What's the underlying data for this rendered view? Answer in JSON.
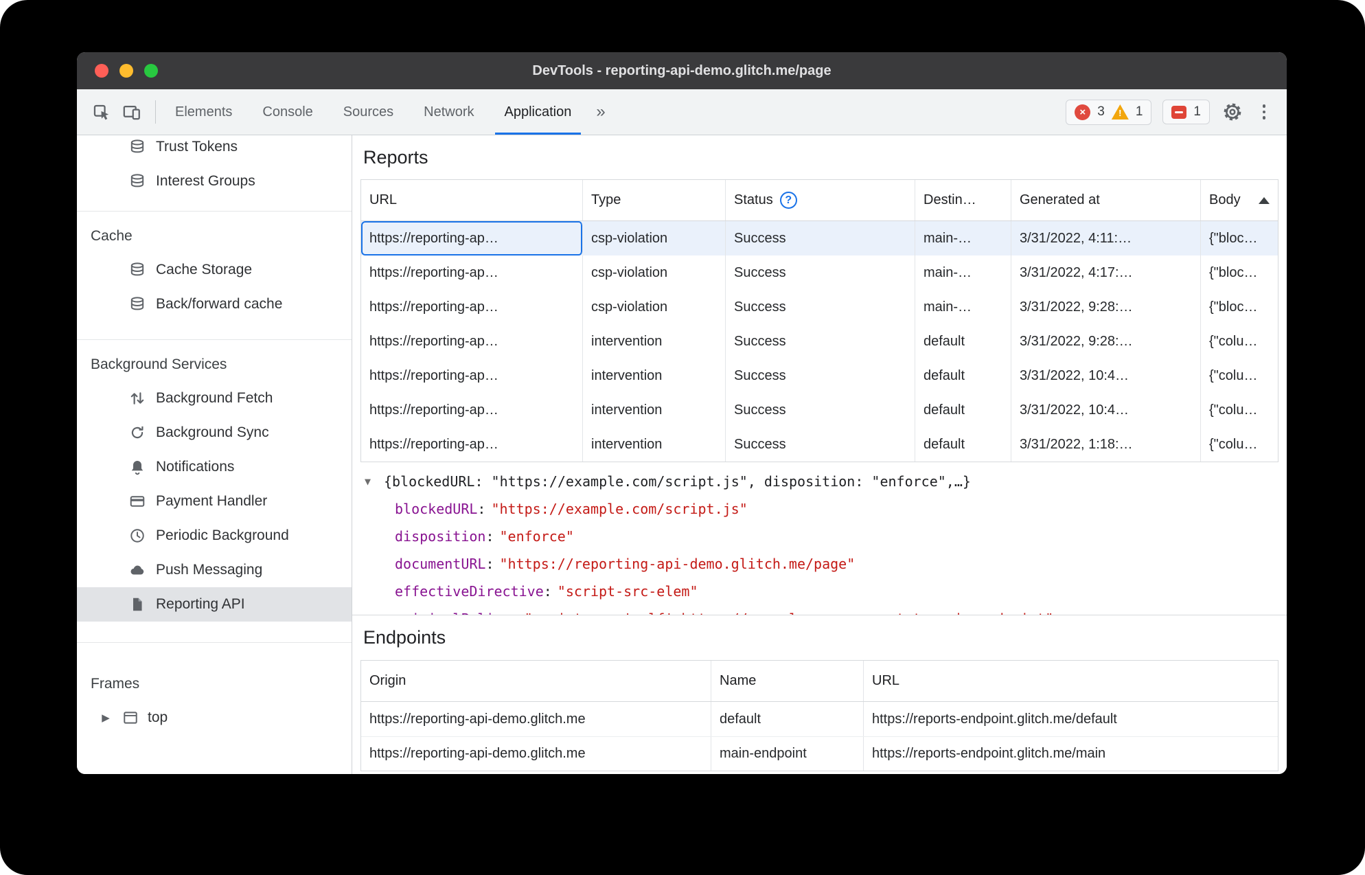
{
  "colors": {
    "accent": "#1a73e8",
    "error": "#e04a3f",
    "warning": "#f2a60d",
    "json_key": "#881391",
    "json_string": "#c41a16",
    "selected_row_bg": "#eaf1fb",
    "selected_sidebar_bg": "#e1e3e6"
  },
  "titlebar": {
    "title": "DevTools - reporting-api-demo.glitch.me/page"
  },
  "toolbar": {
    "tabs": [
      {
        "label": "Elements"
      },
      {
        "label": "Console"
      },
      {
        "label": "Sources"
      },
      {
        "label": "Network"
      },
      {
        "label": "Application"
      }
    ],
    "more_tabs_glyph": "»",
    "error_count": "3",
    "warning_count": "1",
    "issues_count": "1"
  },
  "sidebar": {
    "top_items": {
      "trust_tokens": "Trust Tokens",
      "interest_groups": "Interest Groups"
    },
    "cache": {
      "header": "Cache",
      "cache_storage": "Cache Storage",
      "back_forward_cache": "Back/forward cache"
    },
    "background_services": {
      "header": "Background Services",
      "background_fetch": "Background Fetch",
      "background_sync": "Background Sync",
      "notifications": "Notifications",
      "payment_handler": "Payment Handler",
      "periodic_background": "Periodic Background",
      "push_messaging": "Push Messaging",
      "reporting_api": "Reporting API"
    },
    "frames": {
      "header": "Frames",
      "top": "top"
    }
  },
  "reports": {
    "title": "Reports",
    "columns": {
      "url": "URL",
      "type": "Type",
      "status": "Status",
      "destination": "Destin…",
      "generated": "Generated at",
      "body": "Body"
    },
    "rows": [
      {
        "url": "https://reporting-ap…",
        "type": "csp-violation",
        "status": "Success",
        "destination": "main-…",
        "generated": "3/31/2022, 4:11:…",
        "body": "{\"bloc…"
      },
      {
        "url": "https://reporting-ap…",
        "type": "csp-violation",
        "status": "Success",
        "destination": "main-…",
        "generated": "3/31/2022, 4:17:…",
        "body": "{\"bloc…"
      },
      {
        "url": "https://reporting-ap…",
        "type": "csp-violation",
        "status": "Success",
        "destination": "main-…",
        "generated": "3/31/2022, 9:28:…",
        "body": "{\"bloc…"
      },
      {
        "url": "https://reporting-ap…",
        "type": "intervention",
        "status": "Success",
        "destination": "default",
        "generated": "3/31/2022, 9:28:…",
        "body": "{\"colu…"
      },
      {
        "url": "https://reporting-ap…",
        "type": "intervention",
        "status": "Success",
        "destination": "default",
        "generated": "3/31/2022, 10:4…",
        "body": "{\"colu…"
      },
      {
        "url": "https://reporting-ap…",
        "type": "intervention",
        "status": "Success",
        "destination": "default",
        "generated": "3/31/2022, 10:4…",
        "body": "{\"colu…"
      },
      {
        "url": "https://reporting-ap…",
        "type": "intervention",
        "status": "Success",
        "destination": "default",
        "generated": "3/31/2022, 1:18:…",
        "body": "{\"colu…"
      }
    ]
  },
  "preview": {
    "expander": "▼",
    "summary": "{blockedURL: \"https://example.com/script.js\", disposition: \"enforce\",…}",
    "colon": ":",
    "props": [
      {
        "key": "blockedURL",
        "value": "\"https://example.com/script.js\""
      },
      {
        "key": "disposition",
        "value": "\"enforce\""
      },
      {
        "key": "documentURL",
        "value": "\"https://reporting-api-demo.glitch.me/page\""
      },
      {
        "key": "effectiveDirective",
        "value": "\"script-src-elem\""
      },
      {
        "key": "originalPolicy",
        "value": "\"script-src 'self' https://example.com; report-to main-endpoint\""
      }
    ]
  },
  "endpoints": {
    "title": "Endpoints",
    "columns": {
      "origin": "Origin",
      "name": "Name",
      "url": "URL"
    },
    "rows": [
      {
        "origin": "https://reporting-api-demo.glitch.me",
        "name": "default",
        "url": "https://reports-endpoint.glitch.me/default"
      },
      {
        "origin": "https://reporting-api-demo.glitch.me",
        "name": "main-endpoint",
        "url": "https://reports-endpoint.glitch.me/main"
      }
    ]
  },
  "icons": {
    "status_help": "?",
    "disclosure_collapsed": "▶",
    "error_cross": "×",
    "warning_mark": "!"
  }
}
